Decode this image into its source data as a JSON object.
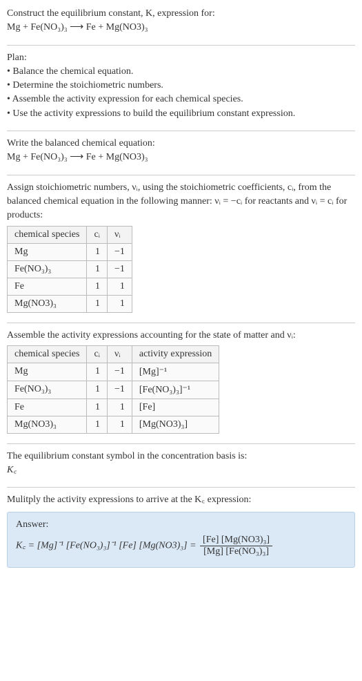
{
  "header": {
    "prompt_line1": "Construct the equilibrium constant, K, expression for:",
    "reaction": "Mg + Fe(NO₃)₃  ⟶  Fe + Mg(NO3)₃"
  },
  "plan": {
    "title": "Plan:",
    "items": [
      "• Balance the chemical equation.",
      "• Determine the stoichiometric numbers.",
      "• Assemble the activity expression for each chemical species.",
      "• Use the activity expressions to build the equilibrium constant expression."
    ]
  },
  "balanced": {
    "title": "Write the balanced chemical equation:",
    "reaction": "Mg + Fe(NO₃)₃  ⟶  Fe + Mg(NO3)₃"
  },
  "stoich": {
    "intro": "Assign stoichiometric numbers, νᵢ, using the stoichiometric coefficients, cᵢ, from the balanced chemical equation in the following manner: νᵢ = −cᵢ for reactants and νᵢ = cᵢ for products:",
    "headers": {
      "species": "chemical species",
      "ci": "cᵢ",
      "vi": "νᵢ"
    },
    "rows": [
      {
        "species": "Mg",
        "ci": "1",
        "vi": "−1"
      },
      {
        "species": "Fe(NO₃)₃",
        "ci": "1",
        "vi": "−1"
      },
      {
        "species": "Fe",
        "ci": "1",
        "vi": "1"
      },
      {
        "species": "Mg(NO3)₃",
        "ci": "1",
        "vi": "1"
      }
    ]
  },
  "activity": {
    "intro": "Assemble the activity expressions accounting for the state of matter and νᵢ:",
    "headers": {
      "species": "chemical species",
      "ci": "cᵢ",
      "vi": "νᵢ",
      "expr": "activity expression"
    },
    "rows": [
      {
        "species": "Mg",
        "ci": "1",
        "vi": "−1",
        "expr": "[Mg]⁻¹"
      },
      {
        "species": "Fe(NO₃)₃",
        "ci": "1",
        "vi": "−1",
        "expr": "[Fe(NO₃)₃]⁻¹"
      },
      {
        "species": "Fe",
        "ci": "1",
        "vi": "1",
        "expr": "[Fe]"
      },
      {
        "species": "Mg(NO3)₃",
        "ci": "1",
        "vi": "1",
        "expr": "[Mg(NO3)₃]"
      }
    ]
  },
  "symbol": {
    "line1": "The equilibrium constant symbol in the concentration basis is:",
    "line2": "K꜀"
  },
  "multiply": {
    "text": "Mulitply the activity expressions to arrive at the K꜀ expression:"
  },
  "answer": {
    "label": "Answer:",
    "lhs": "K꜀ = [Mg]⁻¹ [Fe(NO₃)₃]⁻¹ [Fe] [Mg(NO3)₃] = ",
    "frac_num": "[Fe] [Mg(NO3)₃]",
    "frac_den": "[Mg] [Fe(NO₃)₃]"
  }
}
